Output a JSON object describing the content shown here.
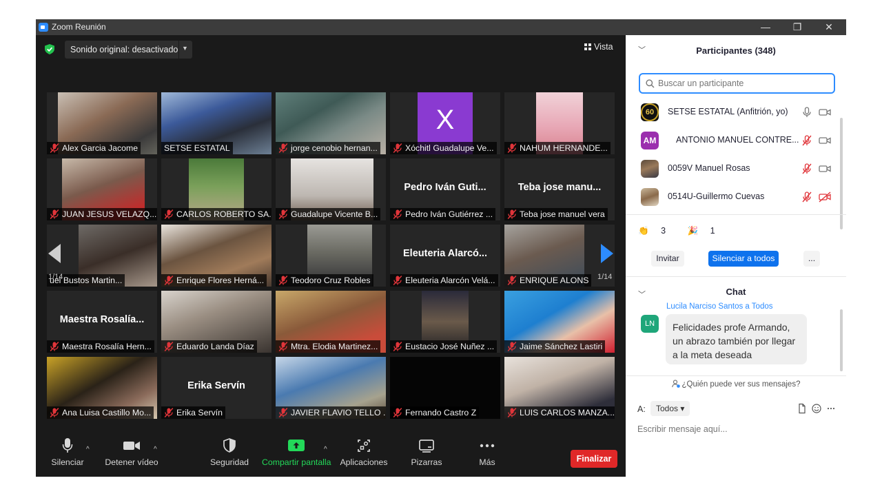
{
  "window": {
    "title": "Zoom Reunión",
    "controls": {
      "minimize": "—",
      "restore": "❐",
      "close": "✕"
    }
  },
  "topbar": {
    "sound_label": "Sonido original: desactivado",
    "view_label": "Vista"
  },
  "pagination": {
    "left": "1/14",
    "right": "1/14"
  },
  "tiles": [
    {
      "name": "Alex Garcia Jacome",
      "muted": true
    },
    {
      "name": "SETSE ESTATAL",
      "muted": false,
      "active": true
    },
    {
      "name": "jorge cenobio hernan...",
      "muted": true
    },
    {
      "name": "Xóchitl Guadalupe Ve...",
      "muted": true,
      "avatar_letter": "X"
    },
    {
      "name": "NAHUM HERNANDE...",
      "muted": true
    },
    {
      "name": "JUAN JESUS VELAZQ...",
      "muted": true
    },
    {
      "name": "CARLOS ROBERTO SA...",
      "muted": true
    },
    {
      "name": "Guadalupe Vicente B...",
      "muted": true
    },
    {
      "name": "Pedro Iván Gutiérrez ...",
      "muted": true,
      "big_name": "Pedro Iván Guti..."
    },
    {
      "name": "Teba jose manuel vera",
      "muted": true,
      "big_name": "Teba jose manu..."
    },
    {
      "name": "uel Bustos Martin...",
      "muted": false
    },
    {
      "name": "Enrique Flores Herná...",
      "muted": true
    },
    {
      "name": "Teodoro Cruz Robles",
      "muted": true
    },
    {
      "name": "Eleuteria Alarcón Velá...",
      "muted": true,
      "big_name": "Eleuteria  Alarcó..."
    },
    {
      "name": "ENRIQUE ALONS",
      "muted": true
    },
    {
      "name": "Maestra Rosalía Hern...",
      "muted": true,
      "big_name": "Maestra  Rosalía..."
    },
    {
      "name": "Eduardo Landa Díaz",
      "muted": true
    },
    {
      "name": "Mtra. Elodia Martinez...",
      "muted": true
    },
    {
      "name": "Eustacio José Nuñez ...",
      "muted": true
    },
    {
      "name": "Jaime Sánchez Lastiri",
      "muted": true
    },
    {
      "name": "Ana Luisa Castillo Mo...",
      "muted": true
    },
    {
      "name": "Erika Servín",
      "muted": true,
      "big_name": "Erika Servín"
    },
    {
      "name": "JAVIER FLAVIO TELLO ...",
      "muted": true
    },
    {
      "name": "Fernando Castro Z",
      "muted": true
    },
    {
      "name": "LUIS CARLOS MANZA...",
      "muted": true
    }
  ],
  "toolbar": {
    "mute": "Silenciar",
    "video": "Detener vídeo",
    "security": "Seguridad",
    "share": "Compartir pantalla",
    "apps": "Aplicaciones",
    "whiteboards": "Pizarras",
    "more": "Más",
    "end": "Finalizar"
  },
  "participants_panel": {
    "title": "Participantes (348)",
    "search_placeholder": "Buscar un participante",
    "list": [
      {
        "name": "SETSE ESTATAL (Anfitrión, yo)",
        "initials": "60",
        "mic": "on",
        "cam": "on"
      },
      {
        "name": "ANTONIO MANUEL CONTRE...",
        "initials": "AM",
        "mic": "off",
        "cam": "on"
      },
      {
        "name": "0059V Manuel Rosas",
        "initials": "",
        "mic": "off",
        "cam": "on"
      },
      {
        "name": "0514U-Guillermo Cuevas",
        "initials": "",
        "mic": "off",
        "cam": "off"
      }
    ],
    "reactions": [
      {
        "emoji": "👏",
        "count": "3"
      },
      {
        "emoji": "🎉",
        "count": "1"
      }
    ],
    "invite": "Invitar",
    "mute_all": "Silenciar a todos",
    "more": "..."
  },
  "chat": {
    "title": "Chat",
    "from": "Lucila Narciso Santos a Todos",
    "sender_initials": "LN",
    "message": "Felicidades profe Armando, un abrazo  también por llegar a la meta  deseada",
    "who_can_see": "¿Quién puede ver sus mensajes?",
    "to_label": "A:",
    "to_value": "Todos",
    "input_placeholder": "Escribir mensaje aquí..."
  },
  "colors": {
    "accent": "#2d8cff",
    "end_button": "#e02828",
    "share_green": "#23d959",
    "muted_red": "#e0353a",
    "active_speaker": "#f5e45a"
  }
}
